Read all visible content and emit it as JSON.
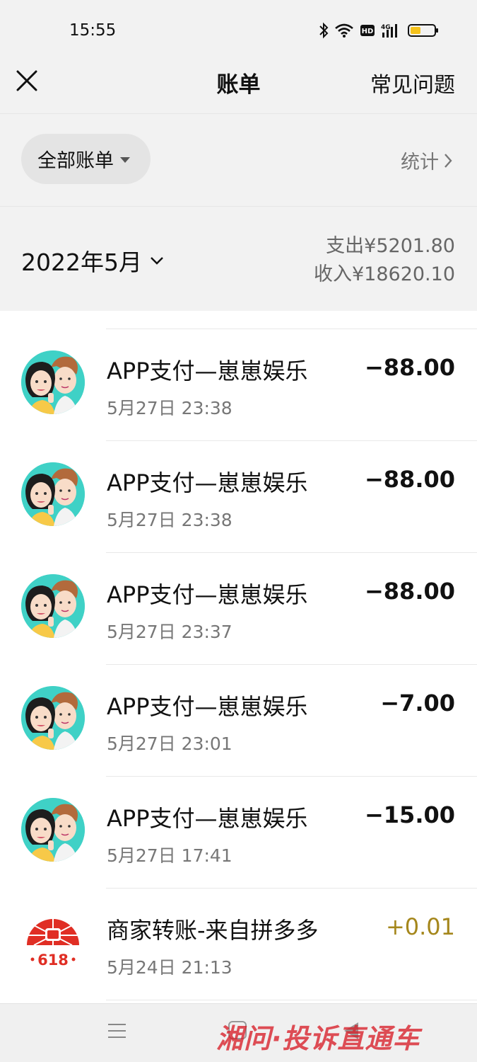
{
  "status_bar": {
    "time": "15:55",
    "icons": [
      "bluetooth-icon",
      "wifi-icon",
      "hd-icon",
      "signal-4g-icon",
      "battery-icon"
    ],
    "hd_label": "HD",
    "network_label": "4G"
  },
  "header": {
    "title": "账单",
    "faq_label": "常见问题",
    "close_icon": "close-icon"
  },
  "filter": {
    "selected": "全部账单",
    "stats_label": "统计"
  },
  "summary": {
    "month": "2022年5月",
    "expense": "支出¥5201.80",
    "income": "收入¥18620.10"
  },
  "transactions": [
    {
      "title": "APP支付—崽崽娱乐",
      "time": "5月27日 23:38",
      "amount": "−88.00",
      "type": "expense",
      "avatar": "avatar-cartoon-couple"
    },
    {
      "title": "APP支付—崽崽娱乐",
      "time": "5月27日 23:38",
      "amount": "−88.00",
      "type": "expense",
      "avatar": "avatar-cartoon-couple"
    },
    {
      "title": "APP支付—崽崽娱乐",
      "time": "5月27日 23:37",
      "amount": "−88.00",
      "type": "expense",
      "avatar": "avatar-cartoon-couple"
    },
    {
      "title": "APP支付—崽崽娱乐",
      "time": "5月27日 23:01",
      "amount": "−7.00",
      "type": "expense",
      "avatar": "avatar-cartoon-couple"
    },
    {
      "title": "APP支付—崽崽娱乐",
      "time": "5月27日 17:41",
      "amount": "−15.00",
      "type": "expense",
      "avatar": "avatar-cartoon-couple"
    },
    {
      "title": "商家转账-来自拼多多",
      "time": "5月24日 21:13",
      "amount": "+0.01",
      "type": "income",
      "avatar": "pinduoduo-618-logo",
      "logo_text": "618"
    }
  ],
  "colors": {
    "income": "#a5871c",
    "background": "#f2f2f2",
    "pdd_red": "#e02e24"
  },
  "watermark": "湘问·投诉直通车"
}
